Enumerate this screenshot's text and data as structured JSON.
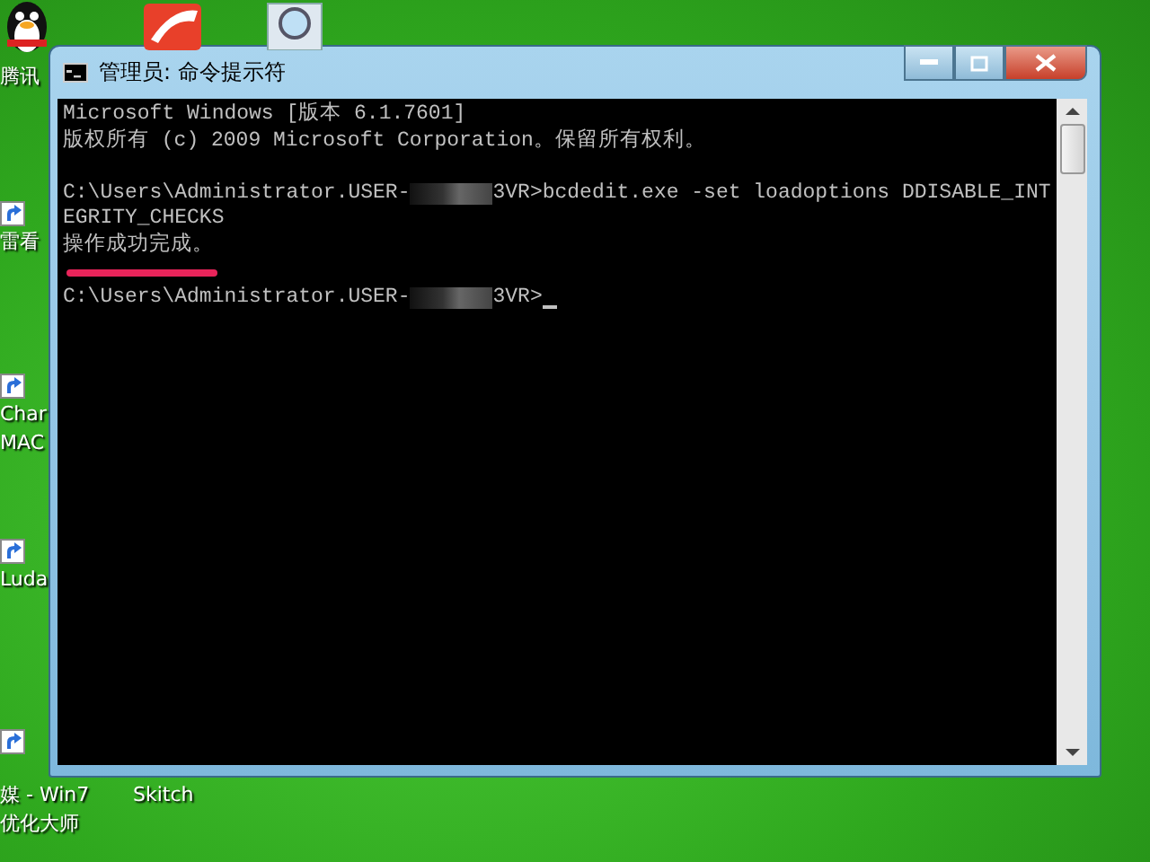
{
  "desktop_icons": [
    {
      "kind": "penguin",
      "lines": [
        "腾讯"
      ]
    },
    {
      "kind": "shortcut",
      "lines": [
        "雷看"
      ]
    },
    {
      "kind": "shortcut",
      "lines": [
        "Char",
        "MAC"
      ]
    },
    {
      "kind": "shortcut",
      "lines": [
        "Luda"
      ]
    },
    {
      "kind": "shortcut",
      "lines": [
        "媒 - Win7",
        "优化大师"
      ]
    },
    {
      "kind": "none",
      "lines": [
        "Skitch"
      ]
    },
    {
      "kind": "swoosh"
    },
    {
      "kind": "magnifier"
    }
  ],
  "window": {
    "title": "管理员: 命令提示符"
  },
  "console": {
    "lines": [
      {
        "kind": "text",
        "text": "Microsoft Windows [版本 6.1.7601]"
      },
      {
        "kind": "text",
        "text": "版权所有 (c) 2009 Microsoft Corporation。保留所有权利。"
      },
      {
        "kind": "blank"
      },
      {
        "kind": "prompt",
        "before": "C:\\Users\\Administrator.USER-",
        "after": "3VR>bcdedit.exe -set loadoptions DDISABLE_INT",
        "cursor": false
      },
      {
        "kind": "text",
        "text": "EGRITY_CHECKS"
      },
      {
        "kind": "text",
        "text": "操作成功完成。"
      },
      {
        "kind": "underline"
      },
      {
        "kind": "prompt",
        "before": "C:\\Users\\Administrator.USER-",
        "after": "3VR>",
        "cursor": true
      }
    ]
  }
}
